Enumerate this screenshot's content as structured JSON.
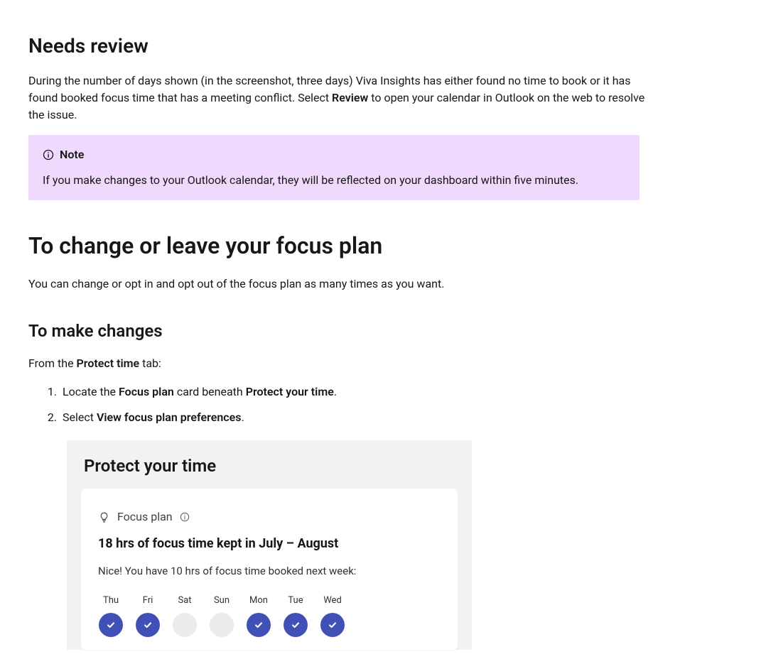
{
  "section1": {
    "heading": "Needs review",
    "paragraph_pre": "During the number of days shown (in the screenshot, three days) Viva Insights has either found no time to book or it has found booked focus time that has a meeting conflict. Select ",
    "paragraph_bold": "Review",
    "paragraph_post": " to open your calendar in Outlook on the web to resolve the issue."
  },
  "note": {
    "label": "Note",
    "body": "If you make changes to your Outlook calendar, they will be reflected on your dashboard within five minutes."
  },
  "section2": {
    "heading": "To change or leave your focus plan",
    "paragraph": "You can change or opt in and opt out of the focus plan as many times as you want."
  },
  "section3": {
    "heading": "To make changes",
    "intro_pre": "From the ",
    "intro_bold": "Protect time",
    "intro_post": " tab:",
    "steps": [
      {
        "pre": "Locate the ",
        "bold1": "Focus plan",
        "mid": " card beneath ",
        "bold2": "Protect your time",
        "post": "."
      },
      {
        "pre": "Select ",
        "bold1": "View focus plan preferences",
        "mid": "",
        "bold2": "",
        "post": "."
      }
    ]
  },
  "screenshot": {
    "title": "Protect your time",
    "card": {
      "header_label": "Focus plan",
      "title": "18 hrs of focus time kept in July – August",
      "subtitle": "Nice! You have 10 hrs of focus time booked next week:",
      "days": [
        {
          "label": "Thu",
          "booked": true
        },
        {
          "label": "Fri",
          "booked": true
        },
        {
          "label": "Sat",
          "booked": false
        },
        {
          "label": "Sun",
          "booked": false
        },
        {
          "label": "Mon",
          "booked": true
        },
        {
          "label": "Tue",
          "booked": true
        },
        {
          "label": "Wed",
          "booked": true
        }
      ]
    }
  }
}
